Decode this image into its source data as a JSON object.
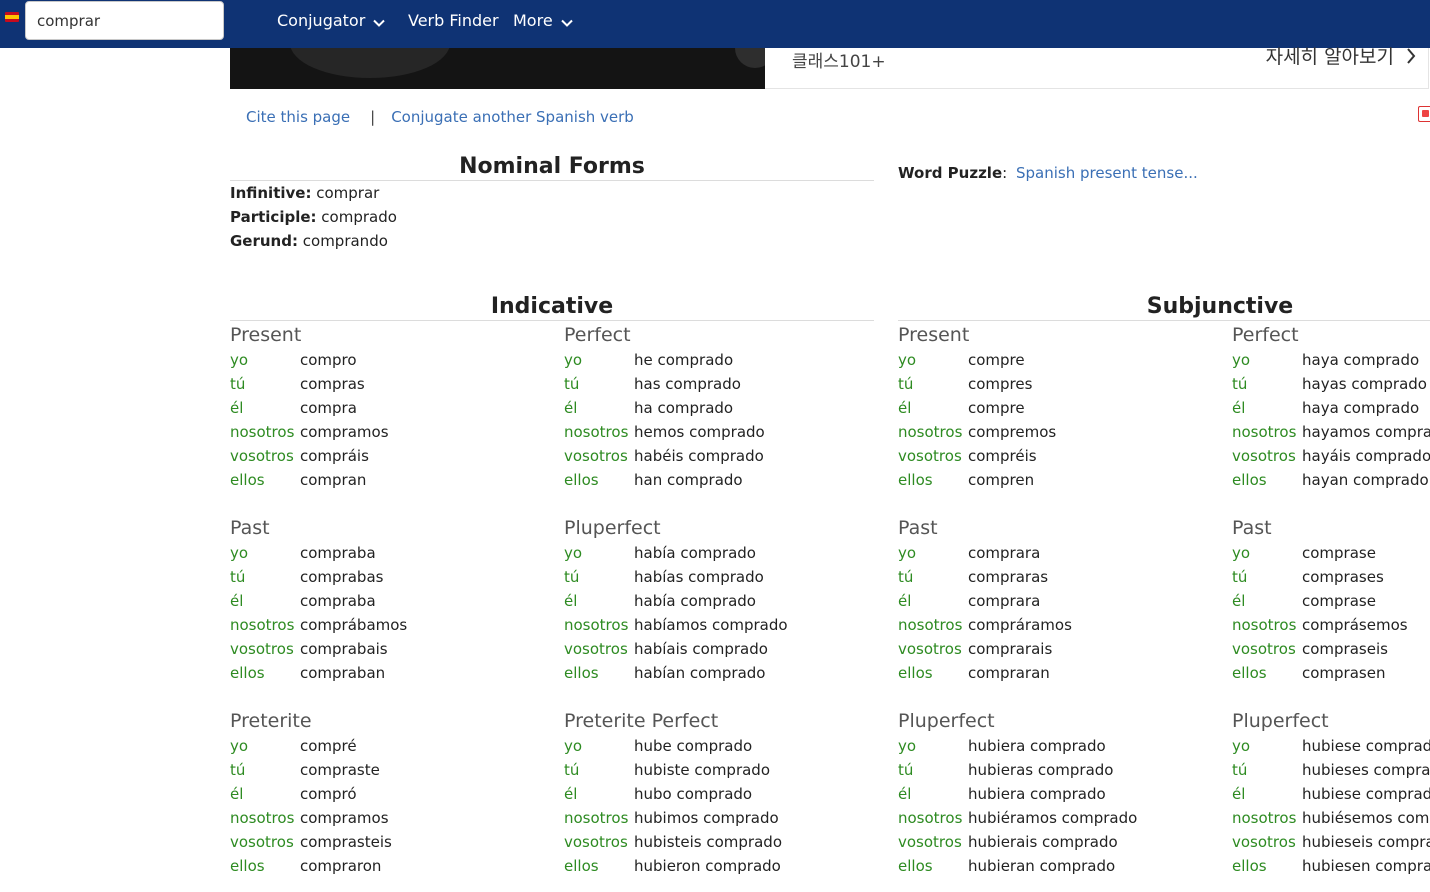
{
  "header": {
    "search_value": "comprar",
    "nav": [
      {
        "label": "Conjugator",
        "dropdown": true
      },
      {
        "label": "Verb Finder",
        "dropdown": false
      },
      {
        "label": "More",
        "dropdown": true
      }
    ]
  },
  "ad": {
    "brand": "클래스101+",
    "cta": "자세히 알아보기"
  },
  "links": {
    "cite": "Cite this page",
    "separator": "|",
    "conjugate_another": "Conjugate another Spanish verb"
  },
  "nominal": {
    "title": "Nominal Forms",
    "rows": [
      {
        "label": "Infinitive:",
        "value": "comprar"
      },
      {
        "label": "Participle:",
        "value": "comprado"
      },
      {
        "label": "Gerund:",
        "value": "comprando"
      }
    ]
  },
  "word_puzzle": {
    "label": "Word Puzzle",
    "colon": ":",
    "link": "Spanish present tense..."
  },
  "pronouns": [
    "yo",
    "tú",
    "él",
    "nosotros",
    "vosotros",
    "ellos"
  ],
  "indicative": {
    "title": "Indicative",
    "tenses": [
      {
        "name": "Present",
        "forms": [
          "compro",
          "compras",
          "compra",
          "compramos",
          "compráis",
          "compran"
        ]
      },
      {
        "name": "Perfect",
        "forms": [
          "he comprado",
          "has comprado",
          "ha comprado",
          "hemos comprado",
          "habéis comprado",
          "han comprado"
        ]
      },
      {
        "name": "Past",
        "forms": [
          "compraba",
          "comprabas",
          "compraba",
          "comprábamos",
          "comprabais",
          "compraban"
        ]
      },
      {
        "name": "Pluperfect",
        "forms": [
          "había comprado",
          "habías comprado",
          "había comprado",
          "habíamos comprado",
          "habíais comprado",
          "habían comprado"
        ]
      },
      {
        "name": "Preterite",
        "forms": [
          "compré",
          "compraste",
          "compró",
          "compramos",
          "comprasteis",
          "compraron"
        ]
      },
      {
        "name": "Preterite Perfect",
        "forms": [
          "hube comprado",
          "hubiste comprado",
          "hubo comprado",
          "hubimos comprado",
          "hubisteis comprado",
          "hubieron comprado"
        ]
      }
    ]
  },
  "subjunctive": {
    "title": "Subjunctive",
    "tenses": [
      {
        "name": "Present",
        "forms": [
          "compre",
          "compres",
          "compre",
          "compremos",
          "compréis",
          "compren"
        ]
      },
      {
        "name": "Perfect",
        "forms": [
          "haya comprado",
          "hayas comprado",
          "haya comprado",
          "hayamos comprad",
          "hayáis comprado",
          "hayan comprado"
        ]
      },
      {
        "name": "Past",
        "forms": [
          "comprara",
          "compraras",
          "comprara",
          "compráramos",
          "comprarais",
          "compraran"
        ]
      },
      {
        "name": "Past",
        "forms": [
          "comprase",
          "comprases",
          "comprase",
          "comprásemos",
          "compraseis",
          "comprasen"
        ]
      },
      {
        "name": "Pluperfect",
        "forms": [
          "hubiera comprado",
          "hubieras comprado",
          "hubiera comprado",
          "hubiéramos comprado",
          "hubierais comprado",
          "hubieran comprado"
        ]
      },
      {
        "name": "Pluperfect",
        "forms": [
          "hubiese comprado",
          "hubieses comprad",
          "hubiese comprado",
          "hubiésemos comp",
          "hubieseis comprac",
          "hubiesen comprac"
        ]
      }
    ]
  }
}
